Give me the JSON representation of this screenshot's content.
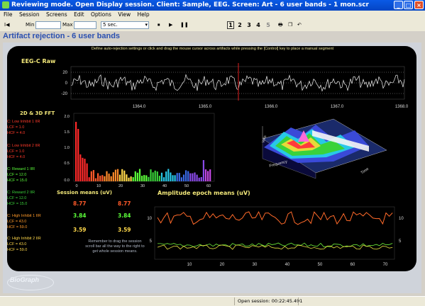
{
  "window": {
    "title": "Reviewing mode. Open Display session. Client: Sample, EEG. Screen: Art - 6 user bands - 1 mon.scr",
    "minimize_glyph": "_",
    "maximize_glyph": "□",
    "close_glyph": "×"
  },
  "menu": [
    "File",
    "Session",
    "Screens",
    "Edit",
    "Options",
    "View",
    "Help"
  ],
  "toolbar": {
    "stop_label": "⏹ ",
    "play_label": "▶ ",
    "pause_label": "❚❚",
    "marker_label": "I◀ ",
    "min_label": "Min",
    "max_label": "Max",
    "timebase_value": "5 sec.",
    "pages": [
      "1",
      "2",
      "3",
      "4",
      "5"
    ],
    "selected_page": "1"
  },
  "heading": "Artifact rejection - 6 user bands",
  "instruction": "Define auto-rejection settings or click and drag the mouse cursor across artifacts while pressing the [Control] key to place a manual segment",
  "eeg": {
    "title": "EEG-C Raw",
    "y_ticks": [
      "20",
      "0",
      "-20"
    ],
    "x_ticks": [
      "1364.0",
      "1365.0",
      "1366.0",
      "1367.0",
      "1368.0"
    ]
  },
  "fft": {
    "title": "2D & 3D FFT",
    "y_ticks": [
      "2.0",
      "1.5",
      "1.0",
      "0.5",
      "0.0"
    ],
    "x_ticks": [
      "0",
      "10",
      "20",
      "30",
      "40",
      "50",
      "60"
    ],
    "axis_labels_3d": [
      "Volts",
      "Frequency",
      "Time"
    ]
  },
  "bands": [
    {
      "name": "C: Low Inhibit 1 IIR",
      "lcf": "LCF = 1.0",
      "hcf": "HCF = 4.0",
      "color": "#ff3a2a"
    },
    {
      "name": "C: Low Inhibit 2 IIR",
      "lcf": "LCF = 1.0",
      "hcf": "HCF = 4.0",
      "color": "#ff3a2a"
    },
    {
      "name": "C: Reward 1 IIR",
      "lcf": "LCF = 12.0",
      "hcf": "HCF = 15.0",
      "color": "#5cff3a"
    },
    {
      "name": "C: Reward 2 IIR",
      "lcf": "LCF = 12.0",
      "hcf": "HCF = 15.0",
      "color": "#3ad23a"
    },
    {
      "name": "C: High Inhibit 1 IIR",
      "lcf": "LCF = 43.0",
      "hcf": "HCF = 59.0",
      "color": "#ff9a2a"
    },
    {
      "name": "C: High Inhibit 2 IIR",
      "lcf": "LCF = 43.0",
      "hcf": "HCF = 59.0",
      "color": "#ffd84a"
    }
  ],
  "session_means": {
    "title": "Session means (uV)",
    "rows": [
      {
        "a": "8.77",
        "b": "8.77",
        "color": "#ff5a2a"
      },
      {
        "a": "3.84",
        "b": "3.84",
        "color": "#5cff3a"
      },
      {
        "a": "3.59",
        "b": "3.59",
        "color": "#ffd84a"
      }
    ]
  },
  "amplitude": {
    "title": "Amplitude epoch means (uV)",
    "y_ticks": [
      "10",
      "5"
    ],
    "x_ticks": [
      "10",
      "20",
      "30",
      "40",
      "50",
      "60",
      "70"
    ]
  },
  "remember_note": "Remember to drag the session scroll bar all the way to the right to get whole session means.",
  "logo": "BioGraph",
  "status": "Open session: 00:22:45.491",
  "colors": {
    "panel": "#000000",
    "heading": "#2a4fb0",
    "titlebar": "#0a5ae6",
    "accent_yellow": "#f4e97a",
    "series_orange": "#ff6a2a",
    "series_green": "#6ef03a",
    "series_yellow": "#e8e040"
  }
}
